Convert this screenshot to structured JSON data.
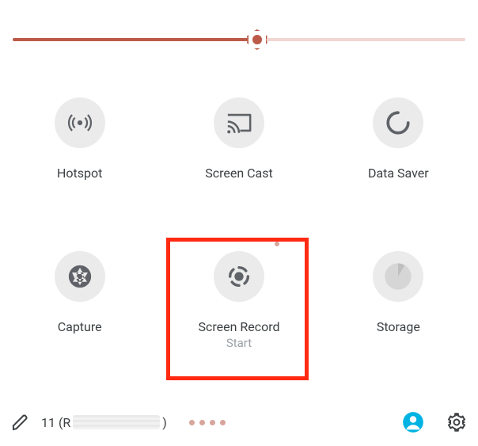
{
  "slider": {
    "percent": 54
  },
  "tiles": [
    {
      "id": "hotspot",
      "label": "Hotspot",
      "sub": ""
    },
    {
      "id": "screen-cast",
      "label": "Screen Cast",
      "sub": ""
    },
    {
      "id": "data-saver",
      "label": "Data Saver",
      "sub": ""
    },
    {
      "id": "capture",
      "label": "Capture",
      "sub": ""
    },
    {
      "id": "screen-record",
      "label": "Screen Record",
      "sub": "Start",
      "highlighted": true
    },
    {
      "id": "storage",
      "label": "Storage",
      "sub": ""
    }
  ],
  "footer": {
    "version_prefix": "11 (R",
    "version_suffix": ")",
    "page_indicator_count": 4
  },
  "colors": {
    "accent": "#bb5a49",
    "highlight": "#ff2a12",
    "avatar": "#00b3e3"
  }
}
